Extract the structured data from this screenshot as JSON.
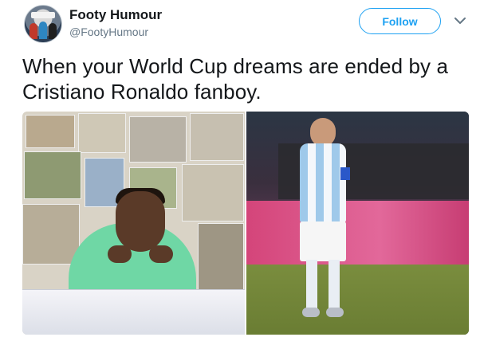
{
  "tweet": {
    "author": {
      "display_name": "Footy Humour",
      "handle": "@FootyHumour",
      "avatar": "footy-humour-avatar"
    },
    "follow_button_label": "Follow",
    "menu_icon": "chevron-down-icon",
    "text": "When your World Cup dreams are ended by a Cristiano Ronaldo fanboy.",
    "media": [
      {
        "name": "young-boy-posters-photo"
      },
      {
        "name": "dejected-player-photo"
      }
    ]
  },
  "colors": {
    "accent": "#1da1f2",
    "text_primary": "#14171a",
    "text_secondary": "#657786"
  }
}
